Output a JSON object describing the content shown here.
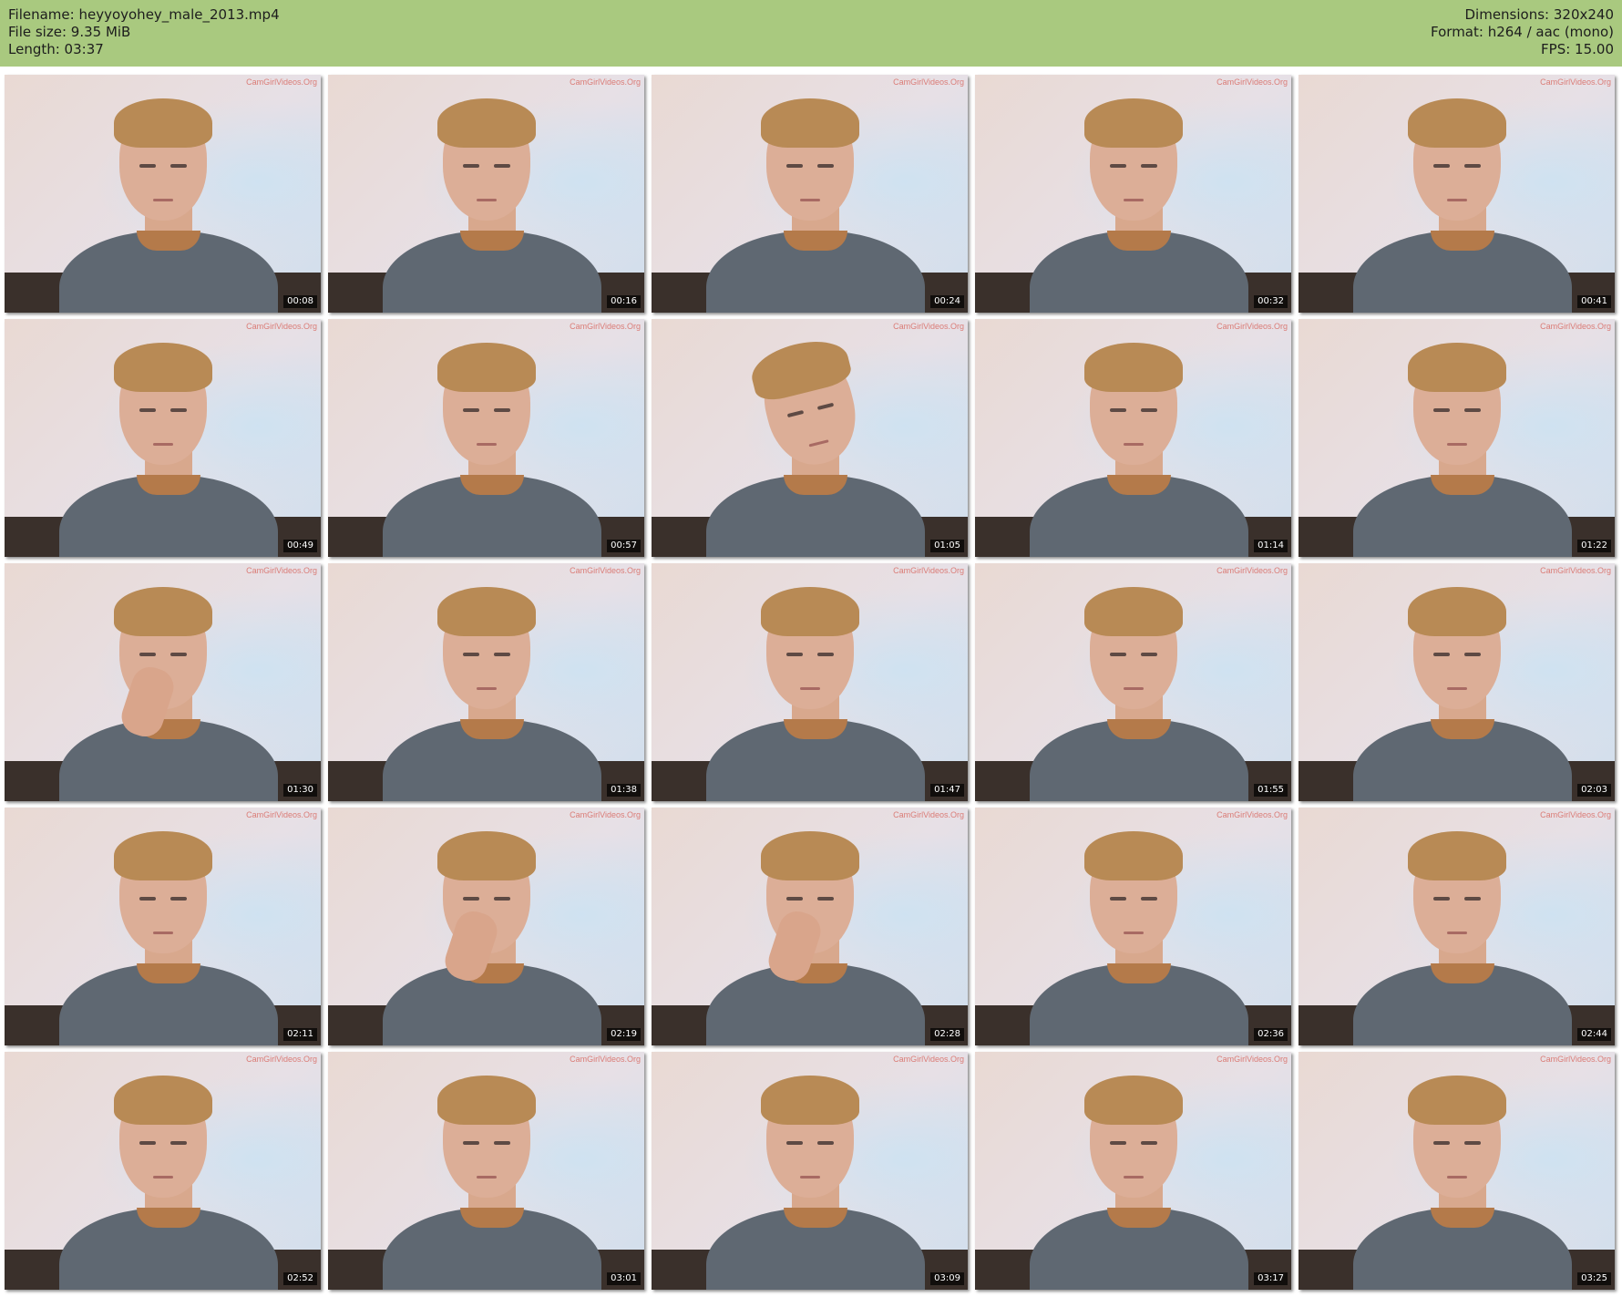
{
  "header": {
    "filename": "Filename: heyyoyohey_male_2013.mp4",
    "file_size": "File size: 9.35 MiB",
    "length": "Length: 03:37",
    "dimensions": "Dimensions: 320x240",
    "format": "Format: h264 / aac (mono)",
    "fps": "FPS: 15.00"
  },
  "thumbnails": [
    {
      "time": "00:08",
      "watermark": "CamGirlVideos.Org"
    },
    {
      "time": "00:16",
      "watermark": "CamGirlVideos.Org"
    },
    {
      "time": "00:24",
      "watermark": "CamGirlVideos.Org"
    },
    {
      "time": "00:32",
      "watermark": "CamGirlVideos.Org"
    },
    {
      "time": "00:41",
      "watermark": "CamGirlVideos.Org"
    },
    {
      "time": "00:49",
      "watermark": "CamGirlVideos.Org"
    },
    {
      "time": "00:57",
      "watermark": "CamGirlVideos.Org"
    },
    {
      "time": "01:05",
      "watermark": "CamGirlVideos.Org"
    },
    {
      "time": "01:14",
      "watermark": "CamGirlVideos.Org"
    },
    {
      "time": "01:22",
      "watermark": "CamGirlVideos.Org"
    },
    {
      "time": "01:30",
      "watermark": "CamGirlVideos.Org"
    },
    {
      "time": "01:38",
      "watermark": "CamGirlVideos.Org"
    },
    {
      "time": "01:47",
      "watermark": "CamGirlVideos.Org"
    },
    {
      "time": "01:55",
      "watermark": "CamGirlVideos.Org"
    },
    {
      "time": "02:03",
      "watermark": "CamGirlVideos.Org"
    },
    {
      "time": "02:11",
      "watermark": "CamGirlVideos.Org"
    },
    {
      "time": "02:19",
      "watermark": "CamGirlVideos.Org"
    },
    {
      "time": "02:28",
      "watermark": "CamGirlVideos.Org"
    },
    {
      "time": "02:36",
      "watermark": "CamGirlVideos.Org"
    },
    {
      "time": "02:44",
      "watermark": "CamGirlVideos.Org"
    },
    {
      "time": "02:52",
      "watermark": "CamGirlVideos.Org"
    },
    {
      "time": "03:01",
      "watermark": "CamGirlVideos.Org"
    },
    {
      "time": "03:09",
      "watermark": "CamGirlVideos.Org"
    },
    {
      "time": "03:17",
      "watermark": "CamGirlVideos.Org"
    },
    {
      "time": "03:25",
      "watermark": "CamGirlVideos.Org"
    }
  ],
  "colors": {
    "header_bg": "#a9c97f",
    "timestamp_bg": "#000000",
    "watermark": "#d86b64"
  }
}
